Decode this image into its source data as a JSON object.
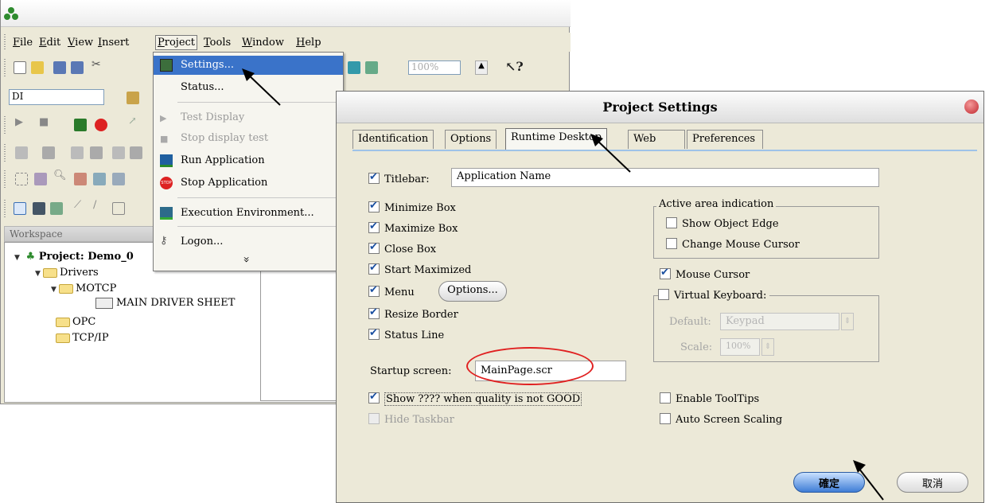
{
  "menubar": {
    "items": [
      {
        "label": "File",
        "u": "F"
      },
      {
        "label": "Edit",
        "u": "E"
      },
      {
        "label": "View",
        "u": "V"
      },
      {
        "label": "Insert",
        "u": "I"
      },
      {
        "label": "Project",
        "u": "P"
      },
      {
        "label": "Tools",
        "u": "T"
      },
      {
        "label": "Window",
        "u": "W"
      },
      {
        "label": "Help",
        "u": "H"
      }
    ]
  },
  "toolbar": {
    "combo_value": "DI",
    "zoom_value": "100%",
    "help_glyph": "?"
  },
  "project_menu": {
    "items": [
      {
        "label": "Settings...",
        "enabled": true,
        "highlighted": true,
        "icon": "settings-icon"
      },
      {
        "label": "Status...",
        "enabled": true,
        "icon": ""
      },
      {
        "label": "Test Display",
        "enabled": false,
        "icon": "play-icon"
      },
      {
        "label": "Stop display test",
        "enabled": false,
        "icon": "stop-small-icon"
      },
      {
        "label": "Run Application",
        "enabled": true,
        "icon": "run-icon"
      },
      {
        "label": "Stop Application",
        "enabled": true,
        "icon": "stop-icon"
      },
      {
        "label": "Execution Environment...",
        "enabled": true,
        "icon": "execution-environment-icon"
      },
      {
        "label": "Logon...",
        "enabled": true,
        "icon": "logon-icon"
      }
    ],
    "more_glyph": "»"
  },
  "workspace": {
    "title": "Workspace",
    "project_label": "Project: Demo_0",
    "nodes": {
      "drivers": "Drivers",
      "motcp": "MOTCP",
      "main_driver_sheet": "MAIN DRIVER SHEET",
      "opc": "OPC",
      "tcpip": "TCP/IP"
    }
  },
  "dialog": {
    "title": "Project Settings",
    "tabs": [
      "Identification",
      "Options",
      "Runtime Desktop",
      "Web",
      "Preferences"
    ],
    "active_tab": "Runtime Desktop",
    "titlebar": {
      "label": "Titlebar:",
      "checked": true,
      "value": "Application Name"
    },
    "left_options": [
      {
        "label": "Minimize Box",
        "checked": true
      },
      {
        "label": "Maximize Box",
        "checked": true
      },
      {
        "label": "Close Box",
        "checked": true
      },
      {
        "label": "Start Maximized",
        "checked": true
      },
      {
        "label": "Menu",
        "checked": true
      },
      {
        "label": "Resize Border",
        "checked": true
      },
      {
        "label": "Status Line",
        "checked": true
      }
    ],
    "options_button": "Options...",
    "active_area": {
      "label": "Active area indication",
      "show_object_edge": {
        "label": "Show Object Edge",
        "checked": false
      },
      "change_mouse_cursor": {
        "label": "Change Mouse Cursor",
        "checked": false
      }
    },
    "mouse_cursor": {
      "label": "Mouse Cursor",
      "checked": true
    },
    "virtual_keyboard": {
      "label": "Virtual Keyboard:",
      "checked": false,
      "default_label": "Default:",
      "default_value": "Keypad",
      "scale_label": "Scale:",
      "scale_value": "100%"
    },
    "startup_screen": {
      "label": "Startup screen:",
      "value": "MainPage.scr"
    },
    "show_quality": {
      "label": "Show ???? when quality is not GOOD",
      "checked": true
    },
    "hide_taskbar": {
      "label": "Hide Taskbar",
      "checked": false,
      "enabled": false
    },
    "enable_tooltips": {
      "label": "Enable ToolTips",
      "checked": false
    },
    "auto_screen_scaling": {
      "label": "Auto Screen Scaling",
      "checked": false
    },
    "ok_button": "確定",
    "cancel_button": "取消"
  }
}
